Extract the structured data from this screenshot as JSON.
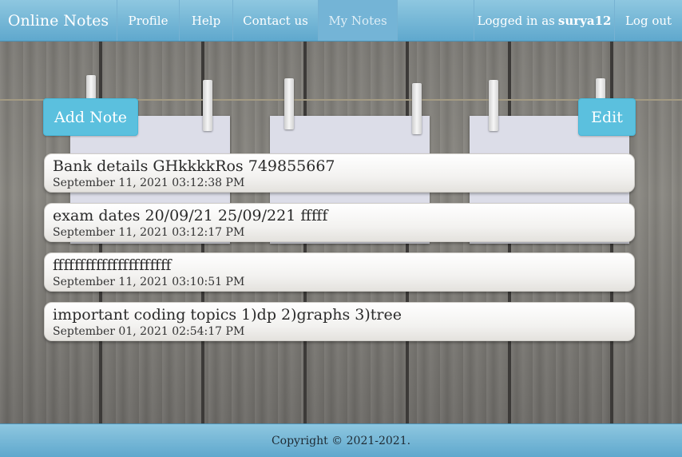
{
  "navbar": {
    "brand": "Online Notes",
    "items": [
      {
        "label": "Profile"
      },
      {
        "label": "Help"
      },
      {
        "label": "Contact us"
      },
      {
        "label": "My Notes",
        "active": true
      }
    ],
    "logged_in_prefix": "Logged in as",
    "username": "surya12",
    "logout": "Log out"
  },
  "actions": {
    "add_note": "Add Note",
    "edit": "Edit"
  },
  "notes": [
    {
      "text": "Bank details GHkkkkRos 749855667",
      "time": "September 11, 2021 03:12:38 PM"
    },
    {
      "text": "exam dates 20/09/21 25/09/221 fffff",
      "time": "September 11, 2021 03:12:17 PM"
    },
    {
      "text": "ffffffffffffffffffffff",
      "time": "September 11, 2021 03:10:51 PM"
    },
    {
      "text": "important coding topics 1)dp 2)graphs 3)tree",
      "time": "September 01, 2021 02:54:17 PM"
    }
  ],
  "footer": {
    "copyright": "Copyright © 2021-2021."
  },
  "colors": {
    "navbar": "#6fb6d8",
    "button": "#5bc0de",
    "active_nav": "#74b4d6"
  }
}
